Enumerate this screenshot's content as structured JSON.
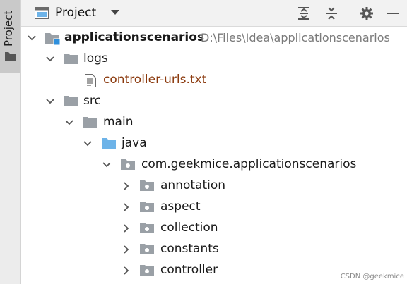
{
  "sidebar": {
    "tab_label": "Project"
  },
  "header": {
    "title": "Project"
  },
  "tree": {
    "root": {
      "label": "applicationscenarios",
      "path": "D:\\Files\\Idea\\applicationscenarios"
    },
    "logs": "logs",
    "controller_urls": "controller-urls.txt",
    "src": "src",
    "main": "main",
    "java": "java",
    "package": "com.geekmice.applicationscenarios",
    "annotation": "annotation",
    "aspect": "aspect",
    "collection": "collection",
    "constants": "constants",
    "controller": "controller"
  },
  "watermark": "CSDN @geekmice",
  "colors": {
    "folder": "#9aa0a6",
    "java_folder": "#6db3e8",
    "file_text": "#8b3a0e"
  }
}
